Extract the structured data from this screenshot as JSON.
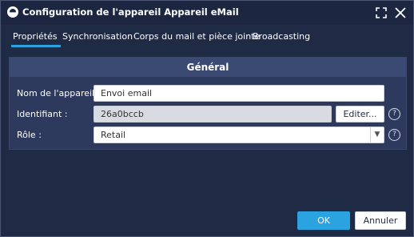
{
  "window": {
    "title": "Configuration de l'appareil Appareil eMail",
    "icon": "app-logo-icon",
    "maximize_icon": "maximize-icon",
    "close_icon": "close-icon"
  },
  "tabs": [
    {
      "label": "Propriétés",
      "active": true
    },
    {
      "label": "Synchronisation",
      "active": false
    },
    {
      "label": "Corps du mail et pièce jointe",
      "active": false
    },
    {
      "label": "Broadcasting",
      "active": false
    }
  ],
  "section": {
    "title": "Général"
  },
  "form": {
    "device_name": {
      "label": "Nom de l'appareil :",
      "value": "Envoi email"
    },
    "identifier": {
      "label": "Identifiant :",
      "value": "26a0bccb",
      "edit_label": "Editer..."
    },
    "role": {
      "label": "Rôle :",
      "value": "Retail"
    },
    "help_glyph": "?"
  },
  "footer": {
    "ok_label": "OK",
    "cancel_label": "Annuler"
  },
  "colors": {
    "background": "#1f2a44",
    "panel": "#2d3a5e",
    "accent": "#2aa3e0"
  }
}
